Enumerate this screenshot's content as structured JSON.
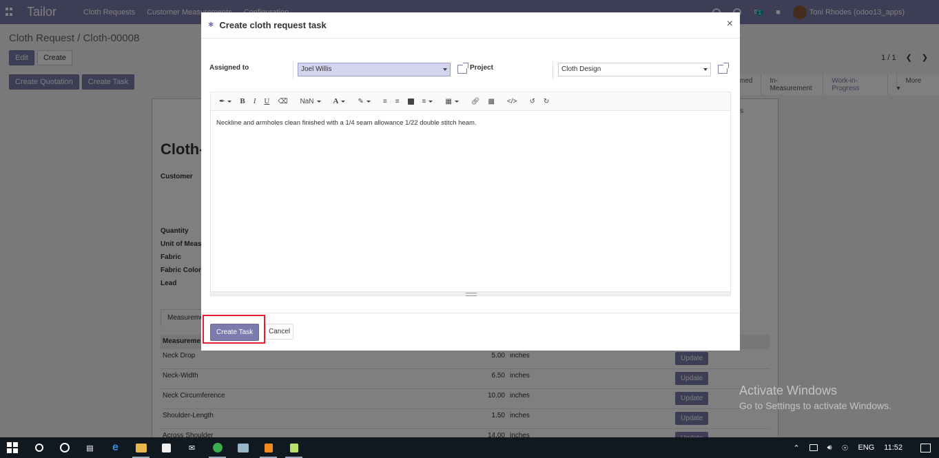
{
  "app": {
    "brand": "Tailor",
    "menu": [
      "Cloth Requests",
      "Customer Measurements",
      "Configuration"
    ],
    "chat_badge": "1",
    "user": "Toni Rhodes (odoo13_apps)"
  },
  "page": {
    "breadcrumb": "Cloth Request / Cloth-00008",
    "edit_label": "Edit",
    "create_label": "Create",
    "create_quotation_label": "Create Quotation",
    "create_task_label": "Create Task",
    "pager": "1 / 1",
    "stages": [
      "med",
      "In-Measurement",
      "Work-in-Progress",
      "More"
    ],
    "record_title": "Cloth-",
    "smart_label": "ks",
    "fields": [
      "Customer",
      "Quantity",
      "Unit of Meas",
      "Fabric",
      "Fabric Color",
      "Lead"
    ],
    "tab_label": "Measureme",
    "table_header": "Measureme",
    "update_label": "Update",
    "rows": [
      {
        "name": "Neck Drop",
        "value": "5.00",
        "unit": "inches"
      },
      {
        "name": "Neck-Width",
        "value": "6.50",
        "unit": "inches"
      },
      {
        "name": "Neck Circumference",
        "value": "10.00",
        "unit": "inches"
      },
      {
        "name": "Shoulder-Length",
        "value": "1.50",
        "unit": "inches"
      },
      {
        "name": "Across Shoulder",
        "value": "14.00",
        "unit": "inches"
      }
    ]
  },
  "modal": {
    "title": "Create cloth request task",
    "close": "×",
    "assigned_label": "Assigned to",
    "assigned_value": "Joel Willis",
    "project_label": "Project",
    "project_value": "Cloth Design",
    "toolbar_font_size": "NaN",
    "description": "Neckline and armholes clean finished with a 1/4 seam allowance 1/22 double stitch heam.",
    "create_task_button": "Create Task",
    "cancel_button": "Cancel"
  },
  "watermark": {
    "line1": "Activate Windows",
    "line2": "Go to Settings to activate Windows."
  },
  "taskbar": {
    "language": "ENG",
    "time": "11:52"
  },
  "colors": {
    "brand": "#7c7bad",
    "highlight": "#e0212b"
  }
}
